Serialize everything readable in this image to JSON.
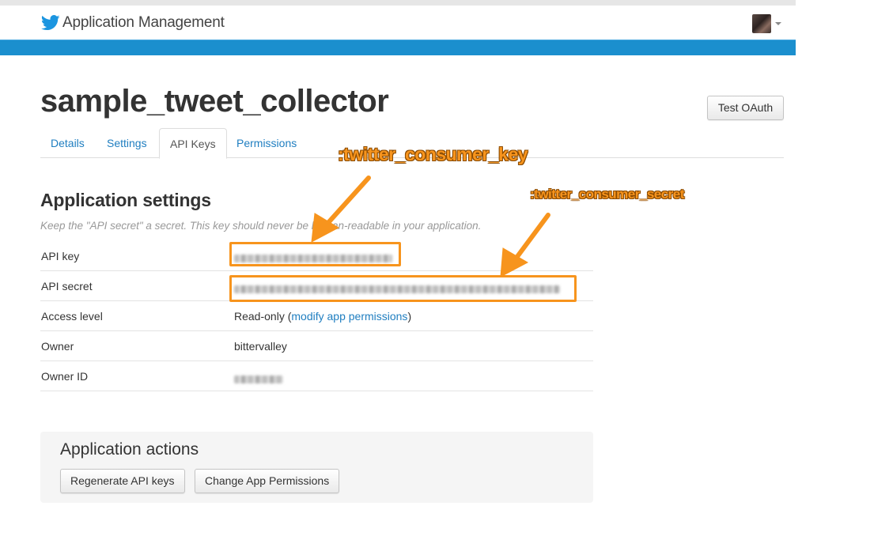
{
  "app": {
    "title": "Application Management"
  },
  "header": {
    "app_name": "sample_tweet_collector",
    "test_oauth_label": "Test OAuth"
  },
  "tabs": [
    {
      "label": "Details",
      "active": false
    },
    {
      "label": "Settings",
      "active": false
    },
    {
      "label": "API Keys",
      "active": true
    },
    {
      "label": "Permissions",
      "active": false
    }
  ],
  "settings": {
    "title": "Application settings",
    "note": "Keep the \"API secret\" a secret. This key should never be human-readable in your application.",
    "rows": [
      {
        "key": "API key",
        "value": ""
      },
      {
        "key": "API secret",
        "value": ""
      },
      {
        "key": "Access level",
        "value_prefix": "Read-only (",
        "link": "modify app permissions",
        "value_suffix": ")"
      },
      {
        "key": "Owner",
        "value": "bittervalley"
      },
      {
        "key": "Owner ID",
        "value": ""
      }
    ]
  },
  "actions": {
    "title": "Application actions",
    "regenerate_label": "Regenerate API keys",
    "change_permissions_label": "Change App Permissions"
  },
  "annotations": {
    "consumer_key": ":twitter_consumer_key",
    "consumer_secret": ":twitter_consumer_secret",
    "color": "#f7941d"
  },
  "colors": {
    "brand_blue": "#1b8fce",
    "link": "#1f7ec0"
  }
}
